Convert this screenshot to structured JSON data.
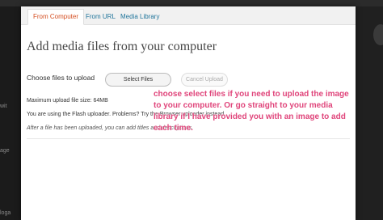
{
  "tabs": [
    {
      "label": "From Computer",
      "active": true
    },
    {
      "label": "From URL",
      "active": false
    },
    {
      "label": "Media Library",
      "active": false
    }
  ],
  "title": "Add media files from your computer",
  "choose_label": "Choose files to upload",
  "buttons": {
    "select": "Select Files",
    "cancel": "Cancel Upload"
  },
  "info": {
    "max_size": "Maximum upload file size: 64MB",
    "flash": "You are using the Flash uploader. Problems? Try the Browser uploader instead.",
    "after": "After a file has been uploaded, you can add titles and descriptions."
  },
  "annotation": "choose select files if you need to upload the image to your computer. Or go straight to your media library if I have provided you with an image to add each time.",
  "background_fragments": [
    "wit",
    "age",
    "loga"
  ],
  "colors": {
    "tab_active": "#d54e21",
    "link": "#21759b",
    "annotation": "#e0457b"
  }
}
